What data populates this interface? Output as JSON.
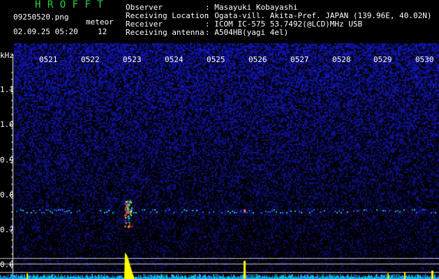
{
  "header": {
    "title": "H R O F F T",
    "filename": "09250520.png",
    "datetime": "02.09.25 05:20",
    "meteor_label": "meteor",
    "meteor_count": "12",
    "observer_label": "Observer",
    "observer_value": ": Masayuki Kobayashi",
    "location_label": "Receiving Location",
    "location_value": ": Ogata-vill. Akita-Pref. JAPAN (139.96E, 40.02N)",
    "receiver_label": "Receiver",
    "receiver_value": ": ICOM IC-575 53.7492(@LCD)MHz USB",
    "antenna_label": "Receiving antenna",
    "antenna_value": ": A504HB(yagi 4el)"
  },
  "axis": {
    "unit": "kHz",
    "time_ticks": [
      "0521",
      "0522",
      "0523",
      "0524",
      "0525",
      "0526",
      "0527",
      "0528",
      "0529",
      "0530"
    ],
    "freq_ticks": [
      "1.1",
      "1.0",
      "0.9",
      "0.8",
      "0.7",
      "0.6"
    ]
  },
  "colors": {
    "background": "#000000",
    "title": "#2bd33b",
    "text": "#ffffff",
    "signal_yellow": "#ffff00",
    "signal_cyan": "#00e0ff",
    "noise_blue": "#1b1fb0"
  }
}
